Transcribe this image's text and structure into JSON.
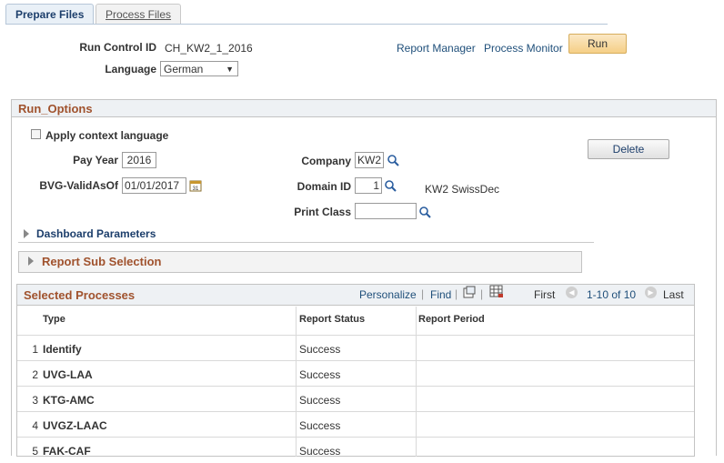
{
  "tabs": {
    "active": "Prepare Files",
    "inactive": "Process Files"
  },
  "header": {
    "run_control_label": "Run Control ID",
    "run_control_value": "CH_KW2_1_2016",
    "language_label": "Language",
    "language_value": "German",
    "report_manager": "Report Manager",
    "process_monitor": "Process Monitor",
    "run_button": "Run"
  },
  "run_options": {
    "title": "Run_Options",
    "apply_context_language": "Apply context language",
    "delete_button": "Delete",
    "pay_year_label": "Pay Year",
    "pay_year_value": "2016",
    "bvg_label": "BVG-ValidAsOf",
    "bvg_value": "01/01/2017",
    "company_label": "Company",
    "company_value": "KW2",
    "domain_label": "Domain ID",
    "domain_value": "1",
    "domain_desc": "KW2 SwissDec",
    "print_class_label": "Print Class",
    "print_class_value": "",
    "dashboard_parameters": "Dashboard Parameters",
    "report_sub_selection": "Report Sub Selection"
  },
  "selected_processes": {
    "title": "Selected Processes",
    "personalize": "Personalize",
    "find": "Find",
    "first": "First",
    "range": "1-10 of 10",
    "last": "Last",
    "columns": [
      "Type",
      "Report Status",
      "Report Period"
    ],
    "rows": [
      {
        "num": "1",
        "type": "Identify",
        "status": "Success",
        "period": ""
      },
      {
        "num": "2",
        "type": "UVG-LAA",
        "status": "Success",
        "period": ""
      },
      {
        "num": "3",
        "type": "KTG-AMC",
        "status": "Success",
        "period": ""
      },
      {
        "num": "4",
        "type": "UVGZ-LAAC",
        "status": "Success",
        "period": ""
      },
      {
        "num": "5",
        "type": "FAK-CAF",
        "status": "Success",
        "period": ""
      }
    ]
  },
  "colors": {
    "accent_title": "#a0522d",
    "link": "#1f4f7a",
    "run_button": "#f5cf86"
  }
}
